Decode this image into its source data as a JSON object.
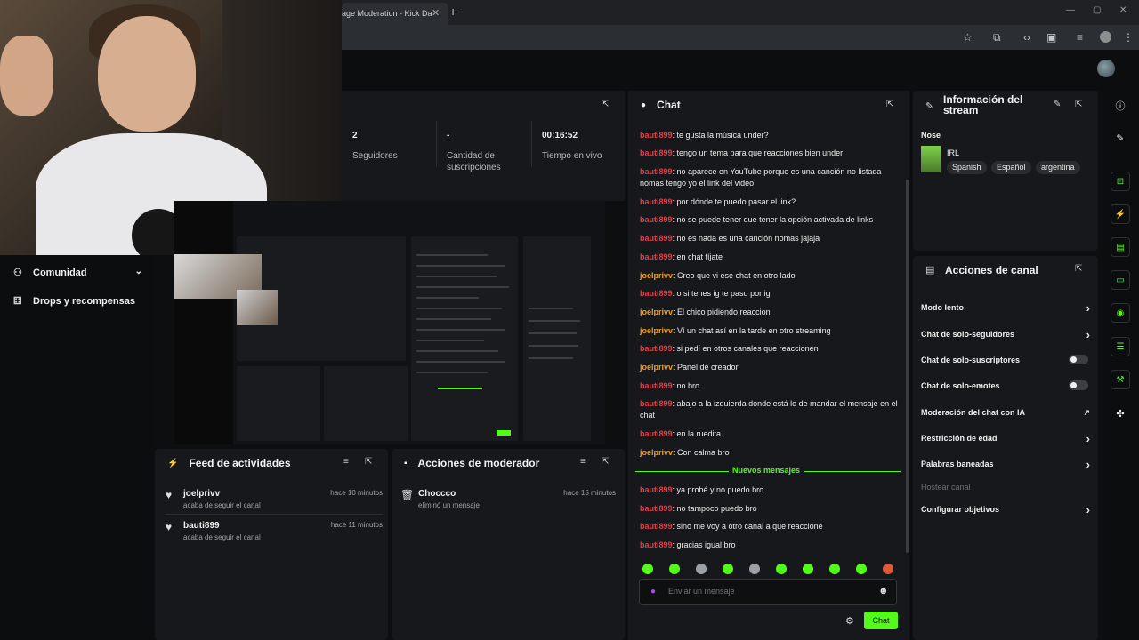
{
  "browser": {
    "tab_title": "age Moderation - Kick Da",
    "tab_close": "✕",
    "new_tab": "+"
  },
  "stats": {
    "followers_value": "2",
    "followers_label": "Seguidores",
    "subs_value": "-",
    "subs_label": "Cantidad de suscripciones",
    "live_value": "00:16:52",
    "live_label": "Tiempo en vivo"
  },
  "sidebar": {
    "items": [
      {
        "label": "Comunidad",
        "icon": "users-icon"
      },
      {
        "label": "Drops y recompensas",
        "icon": "gift-icon"
      }
    ]
  },
  "feed": {
    "title": "Feed de actividades",
    "items": [
      {
        "user": "joelprivv",
        "action": "acaba de seguir el canal",
        "time": "hace 10 minutos"
      },
      {
        "user": "bauti899",
        "action": "acaba de seguir el canal",
        "time": "hace 11 minutos"
      }
    ]
  },
  "moderator": {
    "title": "Acciones de moderador",
    "items": [
      {
        "user": "Choccco",
        "action": "eliminó un mensaje",
        "time": "hace 15 minutos"
      }
    ]
  },
  "chat": {
    "title": "Chat",
    "messages": [
      {
        "user": "bauti899",
        "text": ": te gusta la música under?"
      },
      {
        "user": "bauti899",
        "text": ": tengo un tema para que reacciones bien under"
      },
      {
        "user": "bauti899",
        "text": ": no aparece en YouTube porque es una canción no listada nomas tengo yo el link del video"
      },
      {
        "user": "bauti899",
        "text": ": por dónde te puedo pasar el link?"
      },
      {
        "user": "bauti899",
        "text": ": no se puede tener que tener la opción activada de links"
      },
      {
        "user": "bauti899",
        "text": ": no es nada es una canción nomas jajaja"
      },
      {
        "user": "bauti899",
        "text": ": en chat fíjate"
      },
      {
        "user": "joelprivv",
        "text": ": Creo que vi ese chat en otro lado"
      },
      {
        "user": "bauti899",
        "text": ": o si tenes ig te paso por ig"
      },
      {
        "user": "joelprivv",
        "text": ": El chico pidiendo reaccion"
      },
      {
        "user": "joelprivv",
        "text": ": Ví un chat así en la tarde en otro streaming"
      },
      {
        "user": "bauti899",
        "text": ": si pedí en otros canales que reaccionen"
      },
      {
        "user": "joelprivv",
        "text": ": Panel de creador"
      },
      {
        "user": "bauti899",
        "text": ": no bro"
      },
      {
        "user": "bauti899",
        "text": ": abajo a la izquierda donde está lo de mandar el mensaje en el chat"
      },
      {
        "user": "bauti899",
        "text": ": en la ruedita"
      },
      {
        "user": "joelprivv",
        "text": ": Con calma bro"
      }
    ],
    "new_messages_label": "Nuevos mensajes",
    "new_messages": [
      {
        "user": "bauti899",
        "text": ": ya probé y no puedo bro"
      },
      {
        "user": "bauti899",
        "text": ": no tampoco puedo bro"
      },
      {
        "user": "bauti899",
        "text": ": sino me voy a otro canal a que reaccione"
      },
      {
        "user": "bauti899",
        "text": ": gracias igual bro"
      }
    ],
    "input_placeholder": "Enviar un mensaje",
    "send_label": "Chat"
  },
  "stream_info": {
    "title": "Información del stream",
    "stream_title": "Nose",
    "category": "IRL",
    "tags": [
      "Spanish",
      "Español",
      "argentina"
    ]
  },
  "channel_actions": {
    "title": "Acciones de canal",
    "items": [
      {
        "label": "Modo lento",
        "control": "chevron"
      },
      {
        "label": "Chat de solo-seguidores",
        "control": "chevron"
      },
      {
        "label": "Chat de solo-suscriptores",
        "control": "toggle"
      },
      {
        "label": "Chat de solo-emotes",
        "control": "toggle"
      },
      {
        "label": "Moderación del chat con IA",
        "control": "external"
      },
      {
        "label": "Restricción de edad",
        "control": "chevron"
      },
      {
        "label": "Palabras baneadas",
        "control": "chevron"
      },
      {
        "label": "Hostear canal",
        "control": "disabled"
      },
      {
        "label": "Configurar objetivos",
        "control": "chevron"
      }
    ]
  },
  "colors": {
    "accent": "#53fc18",
    "user_red": "#e0404a",
    "user_orange": "#f0a020",
    "panel": "#17181b"
  }
}
